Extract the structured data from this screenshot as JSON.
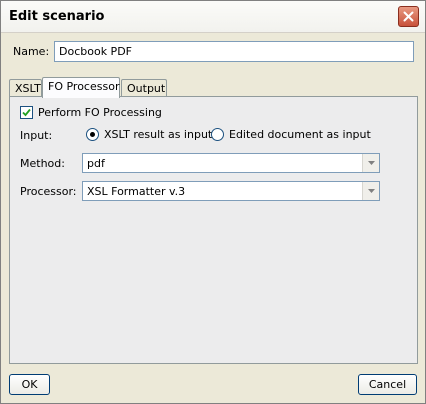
{
  "window": {
    "title": "Edit scenario"
  },
  "name_field": {
    "label": "Name:",
    "value": "Docbook PDF"
  },
  "tabs": [
    {
      "label": "XSLT",
      "active": false
    },
    {
      "label": "FO Processor",
      "active": true
    },
    {
      "label": "Output",
      "active": false
    }
  ],
  "fo_panel": {
    "perform_label": "Perform FO Processing",
    "perform_checked": true,
    "input_label": "Input:",
    "radio_xslt_label": "XSLT result as input",
    "radio_edited_label": "Edited document as input",
    "radio_selected": "xslt",
    "method_label": "Method:",
    "method_value": "pdf",
    "processor_label": "Processor:",
    "processor_value": "XSL Formatter v.3"
  },
  "buttons": {
    "ok": "OK",
    "cancel": "Cancel"
  },
  "icons": {
    "close": "close-icon",
    "dropdown": "chevron-down-icon",
    "check": "checkmark-icon"
  }
}
